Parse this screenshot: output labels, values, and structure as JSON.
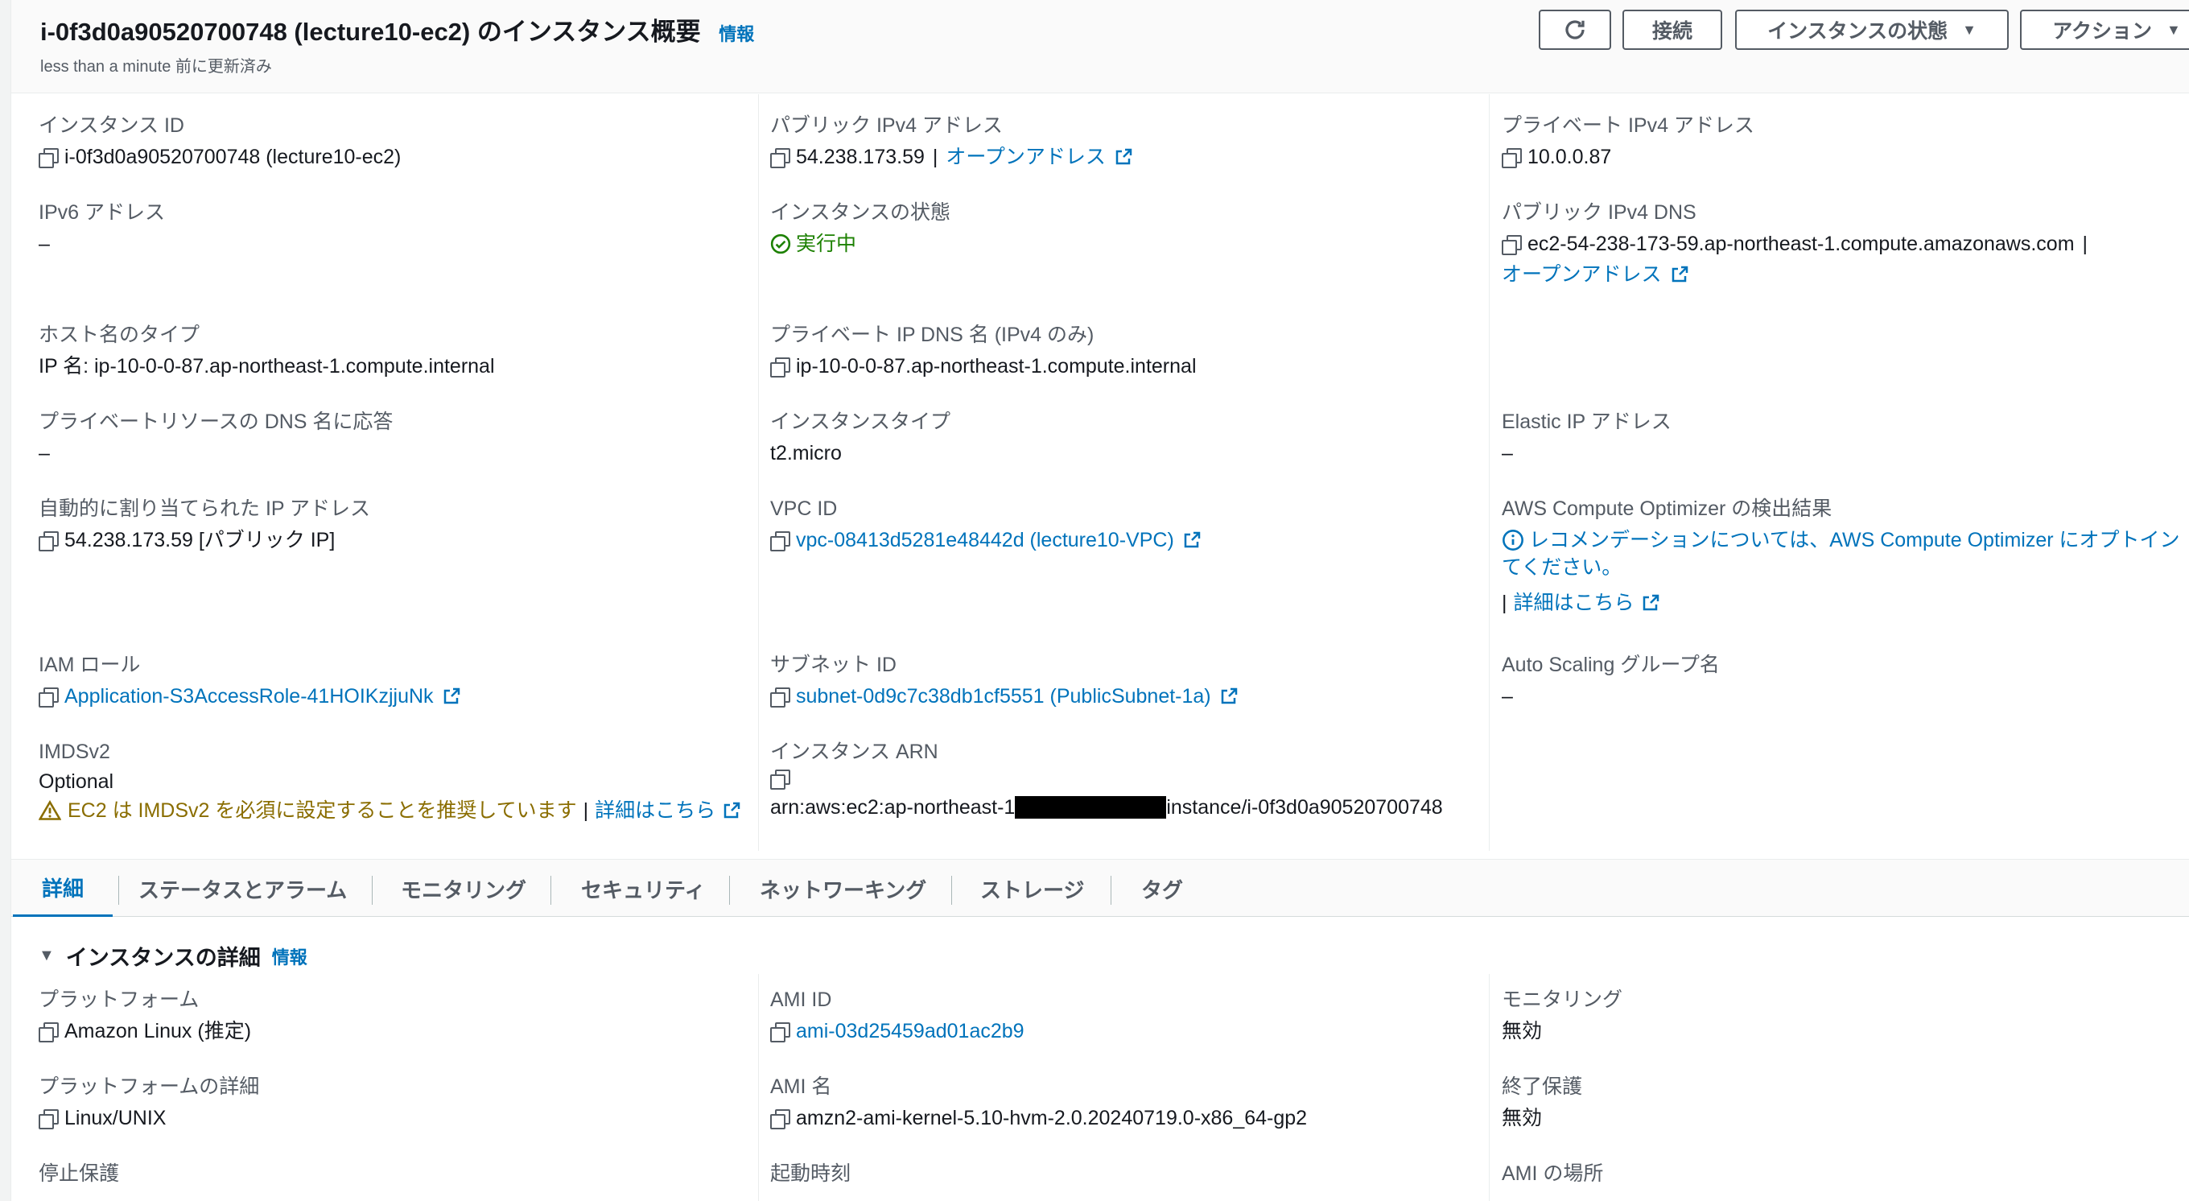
{
  "header": {
    "title": "i-0f3d0a90520700748 (lecture10-ec2) のインスタンス概要",
    "info": "情報",
    "updated": "less than a minute 前に更新済み",
    "buttons": {
      "refresh": "↻",
      "connect": "接続",
      "instance_state": "インスタンスの状態",
      "actions": "アクション"
    }
  },
  "summary": {
    "instance_id": {
      "label": "インスタンス ID",
      "value": "i-0f3d0a90520700748 (lecture10-ec2)"
    },
    "public_ipv4": {
      "label": "パブリック IPv4 アドレス",
      "value": "54.238.173.59",
      "sep": "|",
      "link": "オープンアドレス"
    },
    "private_ipv4": {
      "label": "プライベート IPv4 アドレス",
      "value": "10.0.0.87"
    },
    "ipv6": {
      "label": "IPv6 アドレス",
      "value": "–"
    },
    "instance_state": {
      "label": "インスタンスの状態",
      "value": "実行中"
    },
    "public_dns": {
      "label": "パブリック IPv4 DNS",
      "value": "ec2-54-238-173-59.ap-northeast-1.compute.amazonaws.com",
      "sep": "|",
      "link": "オープンアドレス"
    },
    "hostname_type": {
      "label": "ホスト名のタイプ",
      "value": "IP 名: ip-10-0-0-87.ap-northeast-1.compute.internal"
    },
    "private_dns": {
      "label": "プライベート IP DNS 名 (IPv4 のみ)",
      "value": "ip-10-0-0-87.ap-northeast-1.compute.internal"
    },
    "private_resource_dns": {
      "label": "プライベートリソースの DNS 名に応答",
      "value": "–"
    },
    "instance_type": {
      "label": "インスタンスタイプ",
      "value": "t2.micro"
    },
    "elastic_ip": {
      "label": "Elastic IP アドレス",
      "value": "–"
    },
    "auto_ip": {
      "label": "自動的に割り当てられた IP アドレス",
      "value": "54.238.173.59 [パブリック IP]"
    },
    "vpc_id": {
      "label": "VPC ID",
      "value": "vpc-08413d5281e48442d (lecture10-VPC)"
    },
    "optimizer": {
      "label": "AWS Compute Optimizer の検出結果",
      "line1": "レコメンデーションについては、AWS Compute Optimizer にオプトイン",
      "line2": "てください。",
      "sep": "|",
      "link": "詳細はこちら"
    },
    "iam_role": {
      "label": "IAM ロール",
      "value": "Application-S3AccessRole-41HOIKzjjuNk"
    },
    "subnet_id": {
      "label": "サブネット ID",
      "value": "subnet-0d9c7c38db1cf5551 (PublicSubnet-1a)"
    },
    "asg": {
      "label": "Auto Scaling グループ名",
      "value": "–"
    },
    "imdsv2": {
      "label": "IMDSv2",
      "value": "Optional",
      "warning": "EC2 は IMDSv2 を必須に設定することを推奨しています",
      "sep": "|",
      "link": "詳細はこちら"
    },
    "arn": {
      "label": "インスタンス ARN",
      "prefix": "arn:aws:ec2:ap-northeast-1",
      "suffix": "instance/i-0f3d0a90520700748"
    }
  },
  "tabs": [
    "詳細",
    "ステータスとアラーム",
    "モニタリング",
    "セキュリティ",
    "ネットワーキング",
    "ストレージ",
    "タグ"
  ],
  "details": {
    "title": "インスタンスの詳細",
    "info": "情報",
    "platform": {
      "label": "プラットフォーム",
      "value": "Amazon Linux (推定)"
    },
    "ami_id": {
      "label": "AMI ID",
      "value": "ami-03d25459ad01ac2b9"
    },
    "monitoring": {
      "label": "モニタリング",
      "value": "無効"
    },
    "platform_details": {
      "label": "プラットフォームの詳細",
      "value": "Linux/UNIX"
    },
    "ami_name": {
      "label": "AMI 名",
      "value": "amzn2-ami-kernel-5.10-hvm-2.0.20240719.0-x86_64-gp2"
    },
    "termination": {
      "label": "終了保護",
      "value": "無効"
    },
    "stop_protection": {
      "label": "停止保護"
    },
    "launch_time": {
      "label": "起動時刻"
    },
    "ami_location": {
      "label": "AMI の場所"
    }
  },
  "colors": {
    "link": "#0073bb",
    "ok": "#1d8102",
    "warning": "#8a6d00",
    "text": "#16191f",
    "muted": "#545b64"
  }
}
